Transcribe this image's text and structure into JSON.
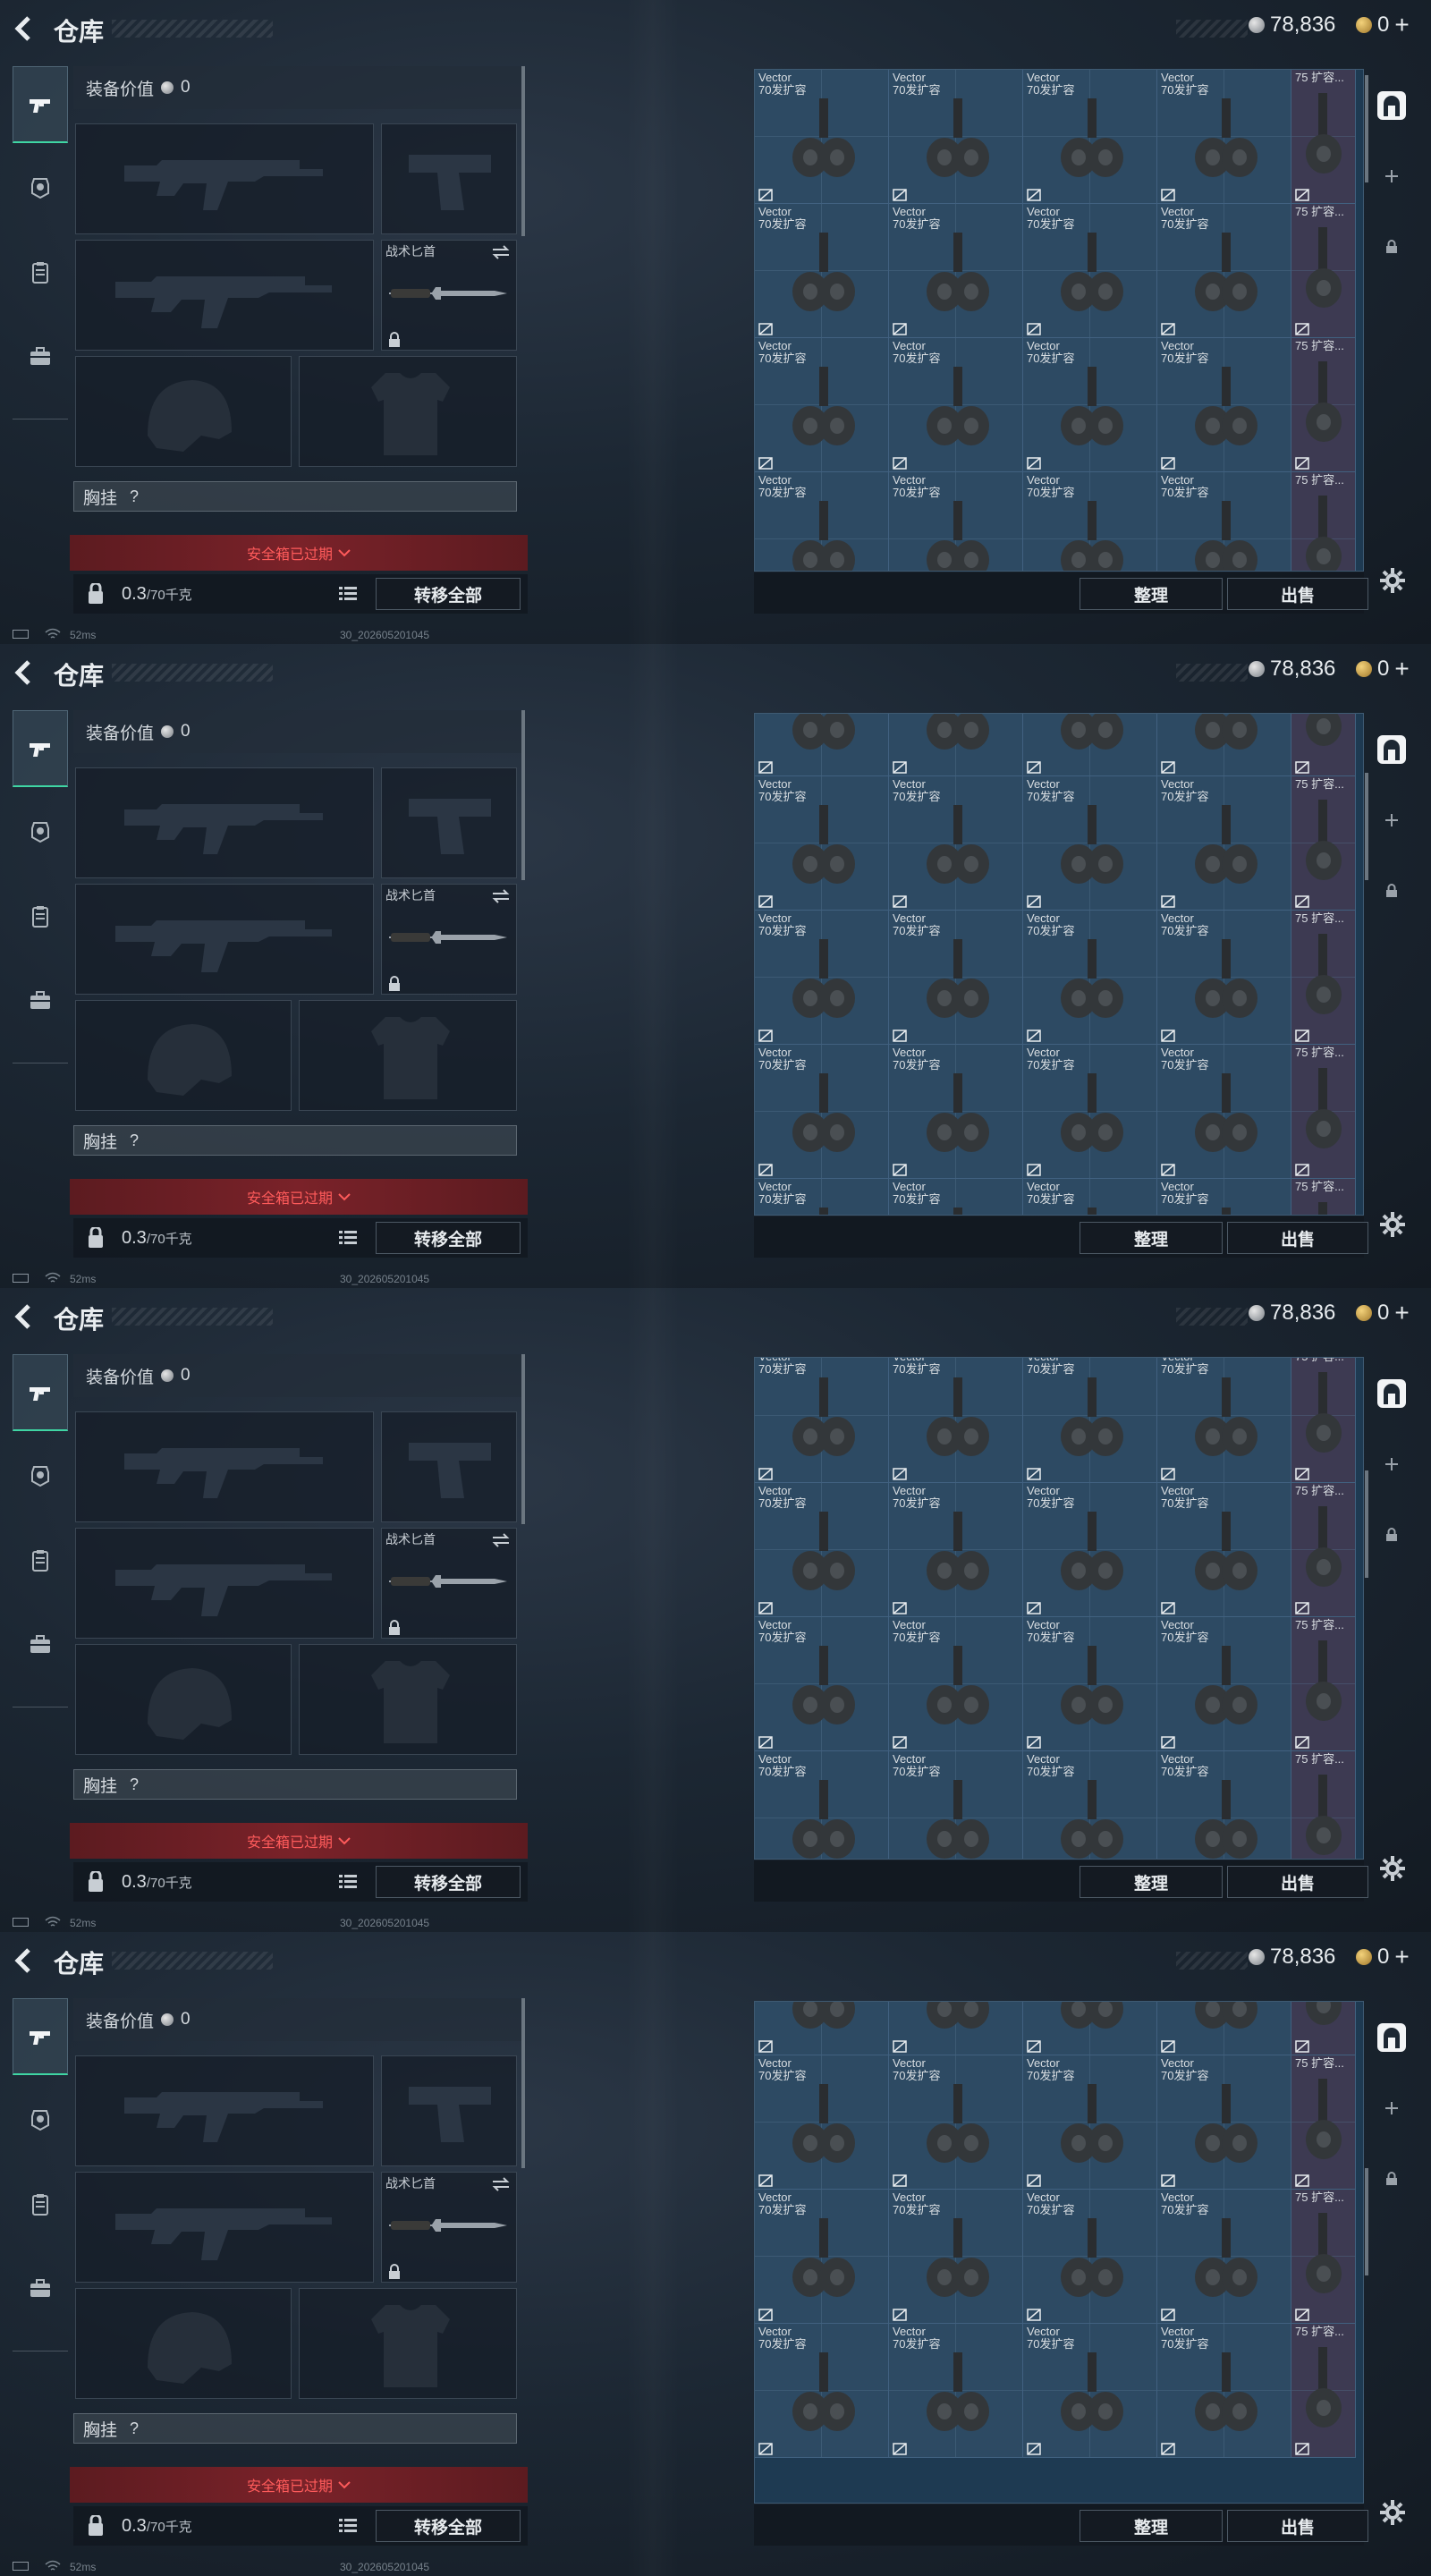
{
  "header": {
    "title": "仓库",
    "silver_amount": "78,836",
    "gold_amount": "0",
    "gold_plus": "+"
  },
  "tabs": [
    {
      "name": "weapon-tab",
      "icon": "pistol-icon",
      "active": true
    },
    {
      "name": "armor-tab",
      "icon": "helmet-badge-icon",
      "active": false
    },
    {
      "name": "clipboard-tab",
      "icon": "clipboard-icon",
      "active": false
    },
    {
      "name": "briefcase-tab",
      "icon": "briefcase-icon",
      "active": false
    }
  ],
  "equipment": {
    "value_label": "装备价值",
    "value": "0",
    "melee_label": "战术匕首",
    "vest_label": "胸挂",
    "vest_hint": "?",
    "safe_box_text": "安全箱已过期",
    "weight_current": "0.3",
    "weight_max": "/70千克",
    "transfer_all": "转移全部"
  },
  "storage": {
    "sort_button": "整理",
    "sell_button": "出售",
    "item_vector_line1": "Vector",
    "item_vector_line2": "70发扩容",
    "item_75_label": "75 扩容..."
  },
  "status_bar": {
    "ping": "52ms",
    "build": "30_202605201045"
  },
  "colors": {
    "accent_green": "#3fd6a4",
    "warning_red": "#ff5b5b",
    "storage_bg": "#2d4a63"
  }
}
